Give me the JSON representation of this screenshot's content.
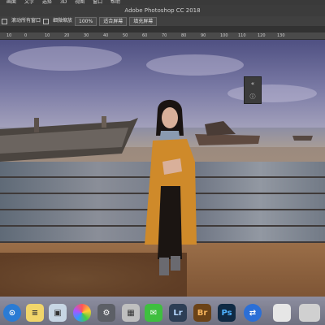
{
  "app": {
    "menubar": [
      "画面",
      "文字",
      "选择",
      "3D",
      "视图",
      "窗口",
      "帮助"
    ],
    "window_title": "Adobe Photoshop CC 2018"
  },
  "options_bar": {
    "scroll_all_windows": "滚动所有窗口",
    "scrubby_zoom": "细微缩放",
    "zoom_percent": "100%",
    "fit_screen": "适合屏幕",
    "fill_screen": "填充屏幕"
  },
  "ruler": {
    "ticks": [
      "10",
      "0",
      "10",
      "20",
      "30",
      "40",
      "50",
      "60",
      "70",
      "80",
      "90",
      "100",
      "110",
      "120",
      "130"
    ]
  },
  "dock": {
    "items": [
      {
        "label": "Lr",
        "color": "#2d3e55"
      },
      {
        "label": "Br",
        "color": "#6b4318"
      },
      {
        "label": "Ps",
        "color": "#0f2a44"
      }
    ]
  },
  "colors": {
    "ps_dark": "#3c3c3c",
    "lr_text": "#b6d7ff",
    "br_text": "#f7b55c",
    "ps_text": "#4fb3ff"
  }
}
